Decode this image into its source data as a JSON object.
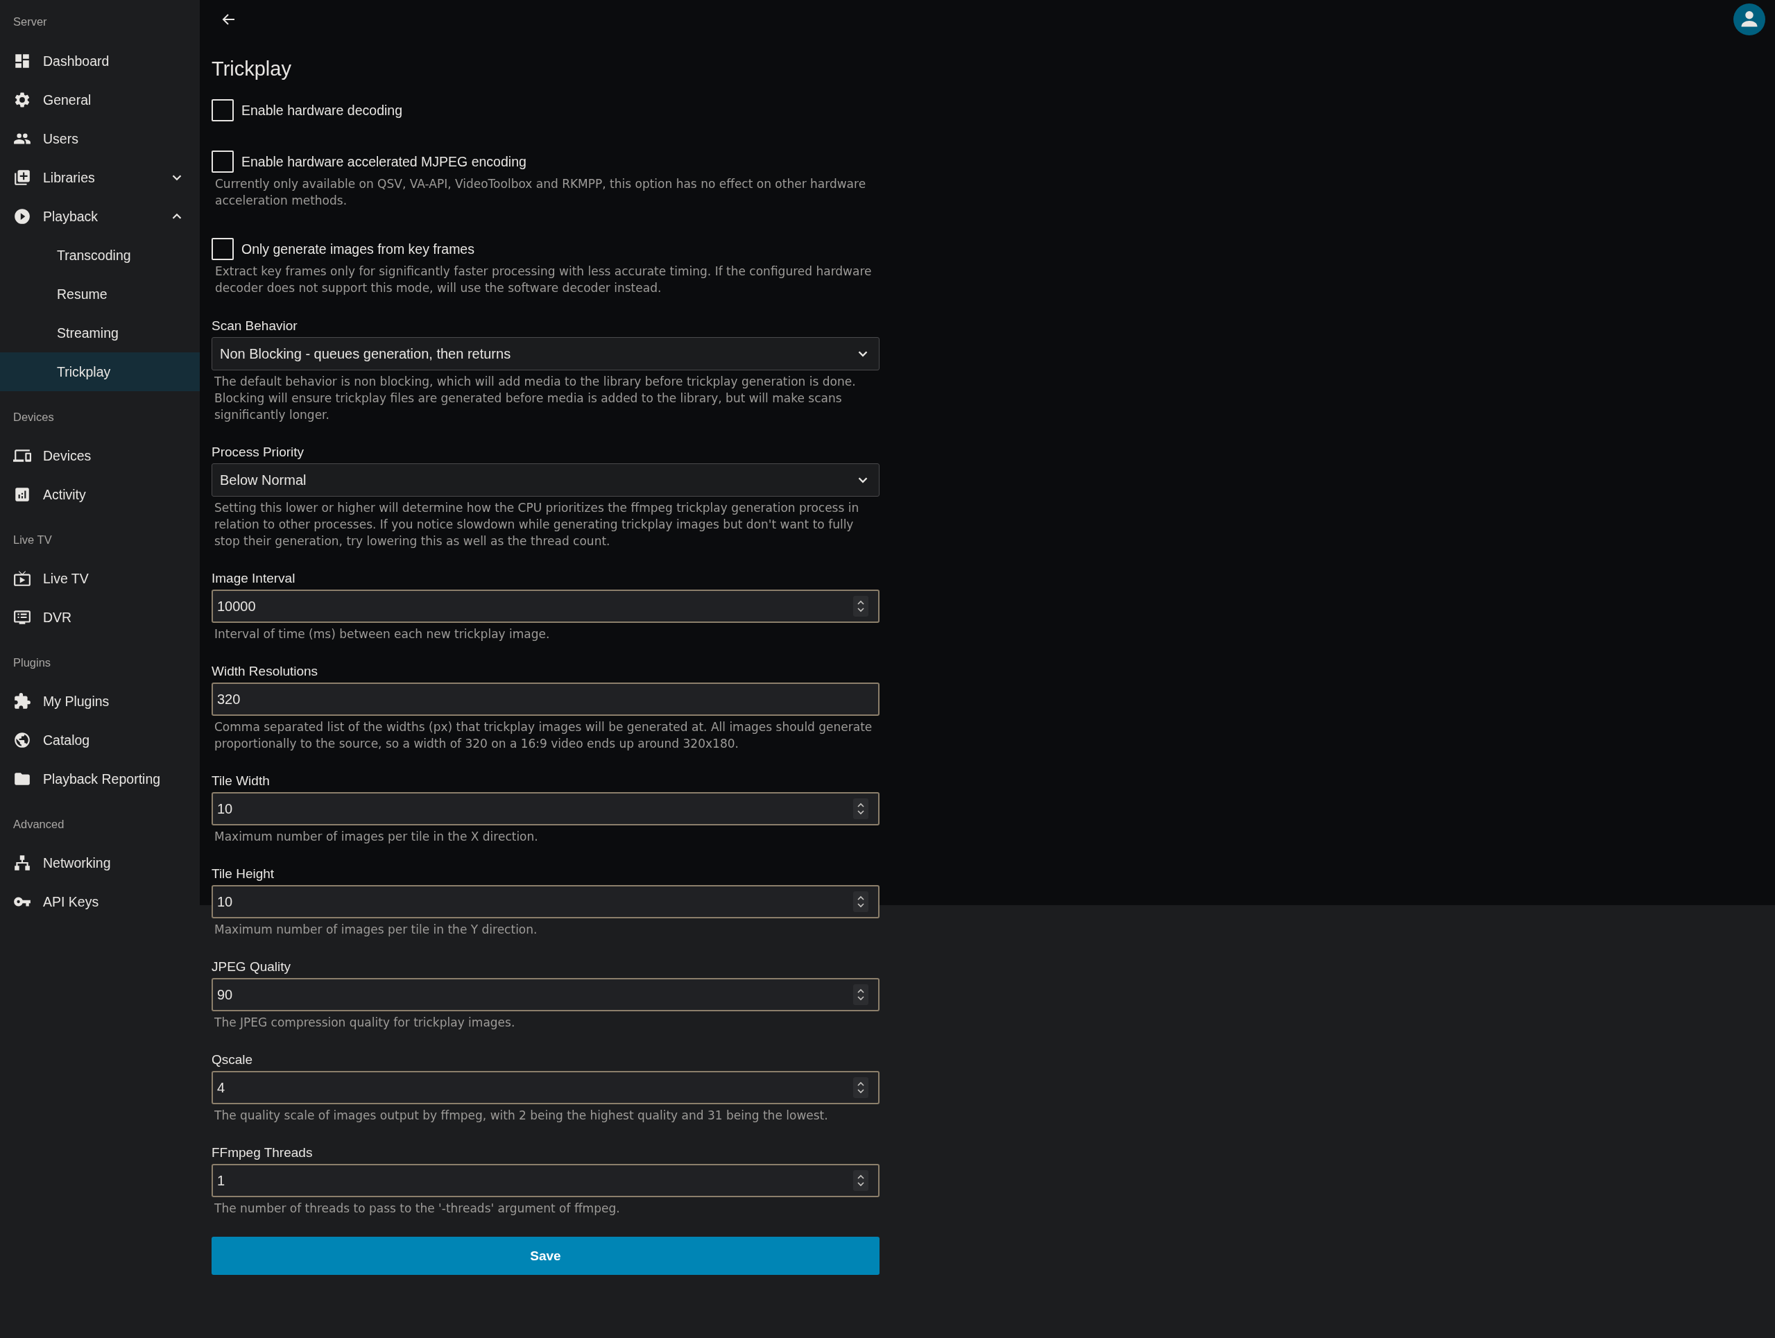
{
  "sidebar": {
    "sections": [
      {
        "title": "Server",
        "items": [
          {
            "label": "Dashboard",
            "selected": false
          },
          {
            "label": "General",
            "selected": false
          },
          {
            "label": "Users",
            "selected": false
          },
          {
            "label": "Libraries",
            "selected": false,
            "expanded": false
          },
          {
            "label": "Playback",
            "selected": false,
            "expanded": true,
            "children": [
              {
                "label": "Transcoding",
                "selected": false
              },
              {
                "label": "Resume",
                "selected": false
              },
              {
                "label": "Streaming",
                "selected": false
              },
              {
                "label": "Trickplay",
                "selected": true
              }
            ]
          }
        ]
      },
      {
        "title": "Devices",
        "items": [
          {
            "label": "Devices",
            "selected": false
          },
          {
            "label": "Activity",
            "selected": false
          }
        ]
      },
      {
        "title": "Live TV",
        "items": [
          {
            "label": "Live TV",
            "selected": false
          },
          {
            "label": "DVR",
            "selected": false
          }
        ]
      },
      {
        "title": "Plugins",
        "items": [
          {
            "label": "My Plugins",
            "selected": false
          },
          {
            "label": "Catalog",
            "selected": false
          },
          {
            "label": "Playback Reporting",
            "selected": false
          }
        ]
      },
      {
        "title": "Advanced",
        "items": [
          {
            "label": "Networking",
            "selected": false
          },
          {
            "label": "API Keys",
            "selected": false
          }
        ]
      }
    ]
  },
  "page": {
    "title": "Trickplay",
    "checkboxes": [
      {
        "label": "Enable hardware decoding",
        "checked": false
      },
      {
        "label": "Enable hardware accelerated MJPEG encoding",
        "checked": false,
        "help": "Currently only available on QSV, VA-API, VideoToolbox and RKMPP, this option has no effect on other hardware acceleration methods."
      },
      {
        "label": "Only generate images from key frames",
        "checked": false,
        "help": "Extract key frames only for significantly faster processing with less accurate timing. If the configured hardware decoder does not support this mode, will use the software decoder instead."
      }
    ],
    "fields": [
      {
        "kind": "select",
        "label": "Scan Behavior",
        "value": "Non Blocking - queues generation, then returns",
        "help": "The default behavior is non blocking, which will add media to the library before trickplay generation is done. Blocking will ensure trickplay files are generated before media is added to the library, but will make scans significantly longer."
      },
      {
        "kind": "select",
        "label": "Process Priority",
        "value": "Below Normal",
        "help": "Setting this lower or higher will determine how the CPU prioritizes the ffmpeg trickplay generation process in relation to other processes. If you notice slowdown while generating trickplay images but don't want to fully stop their generation, try lowering this as well as the thread count."
      },
      {
        "kind": "number",
        "label": "Image Interval",
        "value": "10000",
        "help": "Interval of time (ms) between each new trickplay image."
      },
      {
        "kind": "text",
        "label": "Width Resolutions",
        "value": "320",
        "help": "Comma separated list of the widths (px) that trickplay images will be generated at. All images should generate proportionally to the source, so a width of 320 on a 16:9 video ends up around 320x180."
      },
      {
        "kind": "number",
        "label": "Tile Width",
        "value": "10",
        "help": "Maximum number of images per tile in the X direction."
      },
      {
        "kind": "number",
        "label": "Tile Height",
        "value": "10",
        "help": "Maximum number of images per tile in the Y direction."
      },
      {
        "kind": "number",
        "label": "JPEG Quality",
        "value": "90",
        "help": "The JPEG compression quality for trickplay images."
      },
      {
        "kind": "number",
        "label": "Qscale",
        "value": "4",
        "help": "The quality scale of images output by ffmpeg, with 2 being the highest quality and 31 being the lowest."
      },
      {
        "kind": "number",
        "label": "FFmpeg Threads",
        "value": "1",
        "help": "The number of threads to pass to the '-threads' argument of ffmpeg."
      }
    ],
    "save_button": "Save"
  }
}
